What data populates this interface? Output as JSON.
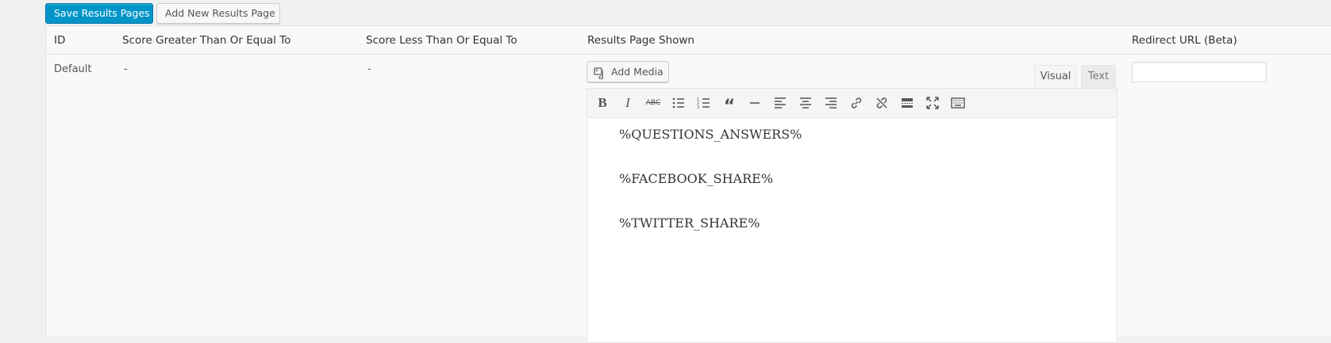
{
  "toolbar": {
    "save_label": "Save Results Pages",
    "add_label": "Add New Results Page"
  },
  "table": {
    "headers": {
      "id": "ID",
      "score_gte": "Score Greater Than Or Equal To",
      "score_lte": "Score Less Than Or Equal To",
      "results_page": "Results Page Shown",
      "redirect": "Redirect URL (Beta)"
    },
    "row": {
      "id": "Default",
      "score_gte": "-",
      "score_lte": "-",
      "redirect_value": ""
    }
  },
  "editor": {
    "add_media_label": "Add Media",
    "tabs": {
      "visual": "Visual",
      "text": "Text"
    },
    "toolbar_icons": [
      "bold-icon",
      "italic-icon",
      "strikethrough-icon",
      "bullet-list-icon",
      "numbered-list-icon",
      "blockquote-icon",
      "horizontal-rule-icon",
      "align-left-icon",
      "align-center-icon",
      "align-right-icon",
      "insert-link-icon",
      "remove-link-icon",
      "read-more-icon",
      "fullscreen-icon",
      "toolbar-toggle-icon"
    ],
    "content": [
      "%QUESTIONS_ANSWERS%",
      "%FACEBOOK_SHARE%",
      "%TWITTER_SHARE%"
    ]
  },
  "colors": {
    "primary_button": "#0095c8",
    "background": "#f1f1f1"
  }
}
